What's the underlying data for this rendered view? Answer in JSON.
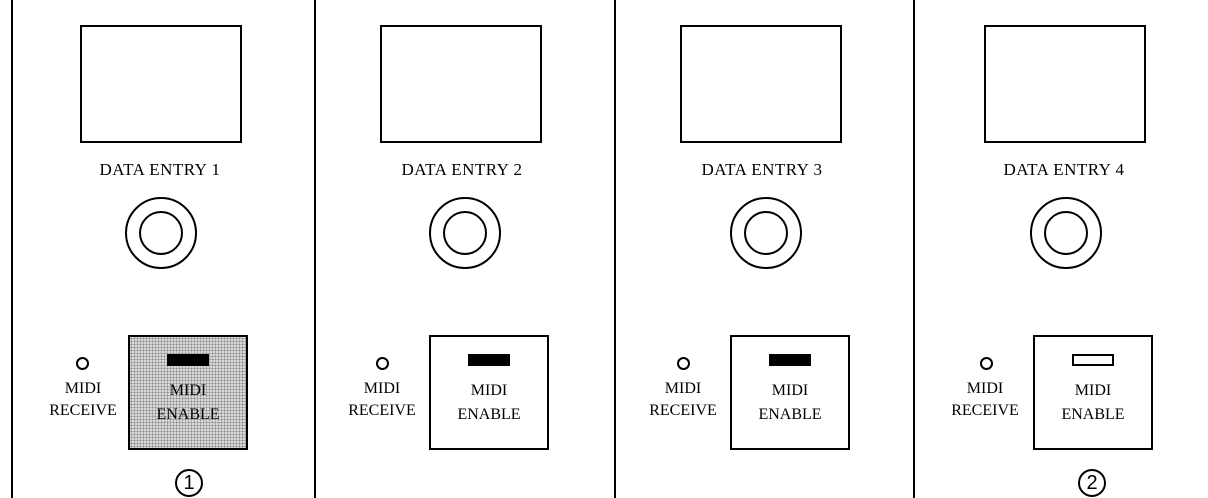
{
  "channels": [
    {
      "entry_label": "DATA ENTRY 1",
      "receive_label_line1": "MIDI",
      "receive_label_line2": "RECEIVE",
      "enable_label_line1": "MIDI",
      "enable_label_line2": "ENABLE",
      "enable_pressed": true,
      "enable_led_lit": true,
      "callout": "1"
    },
    {
      "entry_label": "DATA ENTRY 2",
      "receive_label_line1": "MIDI",
      "receive_label_line2": "RECEIVE",
      "enable_label_line1": "MIDI",
      "enable_label_line2": "ENABLE",
      "enable_pressed": false,
      "enable_led_lit": true
    },
    {
      "entry_label": "DATA ENTRY 3",
      "receive_label_line1": "MIDI",
      "receive_label_line2": "RECEIVE",
      "enable_label_line1": "MIDI",
      "enable_label_line2": "ENABLE",
      "enable_pressed": false,
      "enable_led_lit": true
    },
    {
      "entry_label": "DATA ENTRY 4",
      "receive_label_line1": "MIDI",
      "receive_label_line2": "RECEIVE",
      "enable_label_line1": "MIDI",
      "enable_label_line2": "ENABLE",
      "enable_pressed": false,
      "enable_led_lit": false,
      "callout": "2"
    }
  ]
}
